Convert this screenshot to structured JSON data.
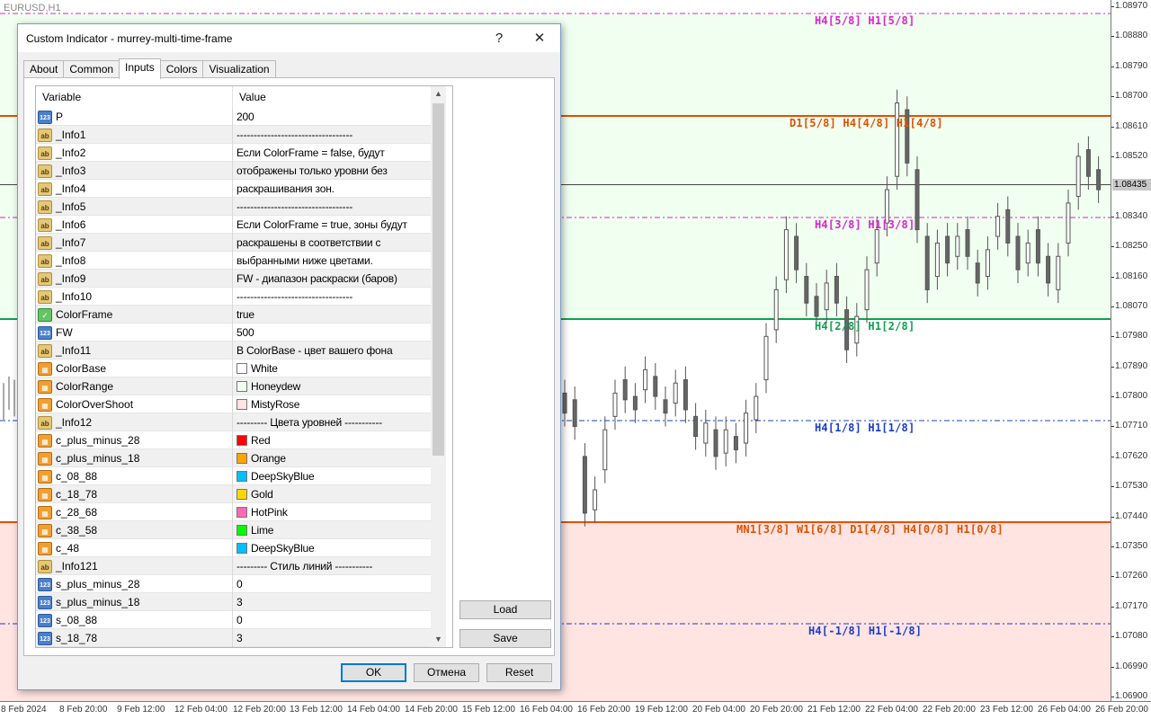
{
  "chart": {
    "symbol": "EURUSD,H1",
    "current_price": "1.08435",
    "price_ticks": [
      "1.08970",
      "1.08880",
      "1.08790",
      "1.08700",
      "1.08610",
      "1.08520",
      "1.08340",
      "1.08250",
      "1.08160",
      "1.08070",
      "1.07980",
      "1.07890",
      "1.07800",
      "1.07710",
      "1.07620",
      "1.07530",
      "1.07440",
      "1.07350",
      "1.07260",
      "1.07170",
      "1.07080",
      "1.06990",
      "1.06900"
    ],
    "time_ticks": [
      "8 Feb 2024",
      "8 Feb 20:00",
      "9 Feb 12:00",
      "12 Feb 04:00",
      "12 Feb 20:00",
      "13 Feb 12:00",
      "14 Feb 04:00",
      "14 Feb 20:00",
      "15 Feb 12:00",
      "16 Feb 04:00",
      "16 Feb 20:00",
      "19 Feb 12:00",
      "20 Feb 04:00",
      "20 Feb 20:00",
      "21 Feb 12:00",
      "22 Feb 04:00",
      "22 Feb 20:00",
      "23 Feb 12:00",
      "26 Feb 04:00",
      "26 Feb 20:00"
    ],
    "levels": [
      {
        "label": "H4[5/8] H1[5/8]",
        "color": "#e020d0"
      },
      {
        "label": "D1[5/8] H4[4/8] H1[4/8]",
        "color": "#e05000"
      },
      {
        "label": "H4[3/8] H1[3/8]",
        "color": "#e020d0"
      },
      {
        "label": "H4[2/8] H1[2/8]",
        "color": "#10a050"
      },
      {
        "label": "H4[1/8] H1[1/8]",
        "color": "#1a3ccc"
      },
      {
        "label": "MN1[3/8] W1[6/8] D1[4/8] H4[0/8] H1[0/8]",
        "color": "#e05000"
      },
      {
        "label": "H4[-1/8] H1[-1/8]",
        "color": "#1a3ccc"
      }
    ]
  },
  "dialog": {
    "title": "Custom Indicator - murrey-multi-time-frame",
    "help_label": "?",
    "close_label": "✕",
    "tabs": [
      "About",
      "Common",
      "Inputs",
      "Colors",
      "Visualization"
    ],
    "active_tab": "Inputs",
    "columns": {
      "variable": "Variable",
      "value": "Value"
    },
    "rows": [
      {
        "icon": "num",
        "name": "P",
        "value": "200"
      },
      {
        "icon": "str",
        "name": "_Info1",
        "value": "----------------------------------"
      },
      {
        "icon": "str",
        "name": "_Info2",
        "value": "Если ColorFrame = false, будут"
      },
      {
        "icon": "str",
        "name": "_Info3",
        "value": "отображены только уровни без"
      },
      {
        "icon": "str",
        "name": "_Info4",
        "value": "раскрашивания зон."
      },
      {
        "icon": "str",
        "name": "_Info5",
        "value": "----------------------------------"
      },
      {
        "icon": "str",
        "name": "_Info6",
        "value": "Если ColorFrame = true, зоны будут"
      },
      {
        "icon": "str",
        "name": "_Info7",
        "value": "раскрашены в соответствии с"
      },
      {
        "icon": "str",
        "name": "_Info8",
        "value": "выбранными ниже цветами."
      },
      {
        "icon": "str",
        "name": "_Info9",
        "value": "FW - диапазон раскраски (баров)"
      },
      {
        "icon": "str",
        "name": "_Info10",
        "value": "----------------------------------"
      },
      {
        "icon": "bool",
        "name": "ColorFrame",
        "value": "true"
      },
      {
        "icon": "num",
        "name": "FW",
        "value": "500"
      },
      {
        "icon": "str",
        "name": "_Info11",
        "value": "В ColorBase - цвет вашего фона"
      },
      {
        "icon": "color",
        "name": "ColorBase",
        "value": "White",
        "swatch": "#ffffff"
      },
      {
        "icon": "color",
        "name": "ColorRange",
        "value": "Honeydew",
        "swatch": "#f0fff0"
      },
      {
        "icon": "color",
        "name": "ColorOverShoot",
        "value": "MistyRose",
        "swatch": "#ffe4e1"
      },
      {
        "icon": "str",
        "name": "_Info12",
        "value": "--------- Цвета уровней -----------"
      },
      {
        "icon": "color",
        "name": "c_plus_minus_28",
        "value": "Red",
        "swatch": "#ff0000"
      },
      {
        "icon": "color",
        "name": "c_plus_minus_18",
        "value": "Orange",
        "swatch": "#ffa500"
      },
      {
        "icon": "color",
        "name": "c_08_88",
        "value": "DeepSkyBlue",
        "swatch": "#00bfff"
      },
      {
        "icon": "color",
        "name": "c_18_78",
        "value": "Gold",
        "swatch": "#ffd700"
      },
      {
        "icon": "color",
        "name": "c_28_68",
        "value": "HotPink",
        "swatch": "#ff69b4"
      },
      {
        "icon": "color",
        "name": "c_38_58",
        "value": "Lime",
        "swatch": "#00ff00"
      },
      {
        "icon": "color",
        "name": "c_48",
        "value": "DeepSkyBlue",
        "swatch": "#00bfff"
      },
      {
        "icon": "str",
        "name": "_Info121",
        "value": "--------- Стиль линий -----------"
      },
      {
        "icon": "num",
        "name": "s_plus_minus_28",
        "value": "0"
      },
      {
        "icon": "num",
        "name": "s_plus_minus_18",
        "value": "3"
      },
      {
        "icon": "num",
        "name": "s_08_88",
        "value": "0"
      },
      {
        "icon": "num",
        "name": "s_18_78",
        "value": "3"
      }
    ],
    "icon_text": {
      "num": "123",
      "str": "ab",
      "bool": "✓",
      "color": "▦"
    },
    "buttons": {
      "load": "Load",
      "save": "Save",
      "ok": "OK",
      "cancel": "Отмена",
      "reset": "Reset"
    }
  }
}
